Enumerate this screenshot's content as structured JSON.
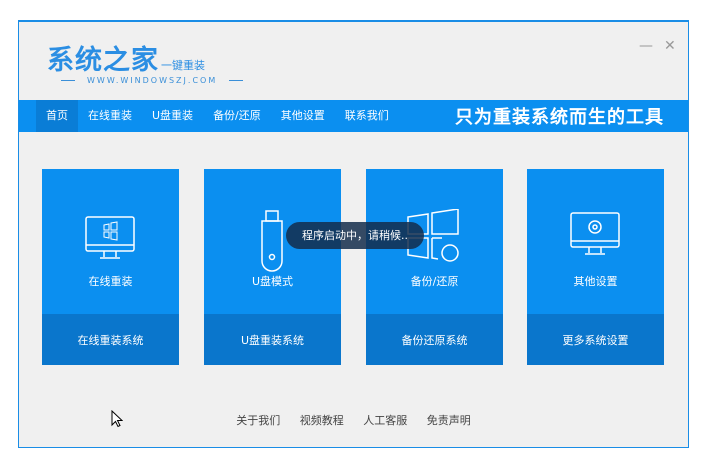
{
  "logo": {
    "main": "系统之家",
    "sub": "一键重装",
    "url": "WWW.WINDOWSZJ.COM"
  },
  "window": {
    "minimize": "—",
    "close": "✕"
  },
  "nav": {
    "items": [
      "首页",
      "在线重装",
      "U盘重装",
      "备份/还原",
      "其他设置",
      "联系我们"
    ],
    "slogan": "只为重装系统而生的工具"
  },
  "cards": [
    {
      "title": "在线重装",
      "foot": "在线重装系统",
      "icon": "monitor-windows-icon"
    },
    {
      "title": "U盘模式",
      "foot": "U盘重装系统",
      "icon": "usb-drive-icon"
    },
    {
      "title": "备份/还原",
      "foot": "备份还原系统",
      "icon": "windows-restore-icon"
    },
    {
      "title": "其他设置",
      "foot": "更多系统设置",
      "icon": "monitor-gear-icon"
    }
  ],
  "toast": "程序启动中，请稍候..",
  "footer": [
    "关于我们",
    "视频教程",
    "人工客服",
    "免责声明"
  ]
}
